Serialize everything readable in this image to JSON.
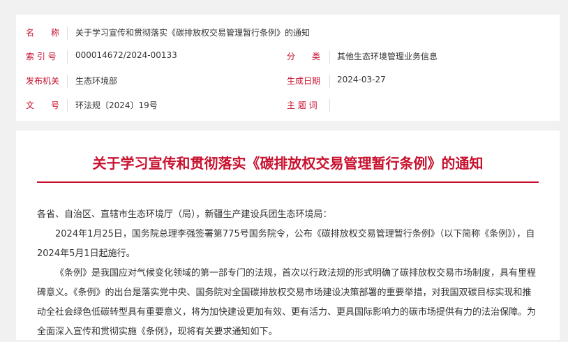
{
  "meta": {
    "name_label": "名　　称",
    "name_value": "关于学习宣传和贯彻落实《碳排放权交易管理暂行条例》的通知",
    "index_label": "索 引 号",
    "index_value": "000014672/2024-00133",
    "category_label": "分　　类",
    "category_value": "其他生态环境管理业务信息",
    "issuer_label": "发布机关",
    "issuer_value": "生态环境部",
    "date_label": "生成日期",
    "date_value": "2024-03-27",
    "docno_label": "文　　号",
    "docno_value": "环法规〔2024〕19号",
    "subject_label": "主 题 词",
    "subject_value": ""
  },
  "article": {
    "title": "关于学习宣传和贯彻落实《碳排放权交易管理暂行条例》的通知",
    "salutation": "各省、自治区、直辖市生态环境厅（局），新疆生产建设兵团生态环境局：",
    "para1": "2024年1月25日，国务院总理李强签署第775号国务院令，公布《碳排放权交易管理暂行条例》（以下简称《条例》），自2024年5月1日起施行。",
    "para2": "《条例》是我国应对气候变化领域的第一部专门的法规，首次以行政法规的形式明确了碳排放权交易市场制度，具有里程碑意义。《条例》的出台是落实党中央、国务院对全国碳排放权交易市场建设决策部署的重要举措，对我国双碳目标实现和推动全社会绿色低碳转型具有重要意义，将为加快建设更加有效、更有活力、更具国际影响力的碳市场提供有力的法治保障。为全面深入宣传和贯彻实施《条例》，现将有关要求通知如下。"
  }
}
